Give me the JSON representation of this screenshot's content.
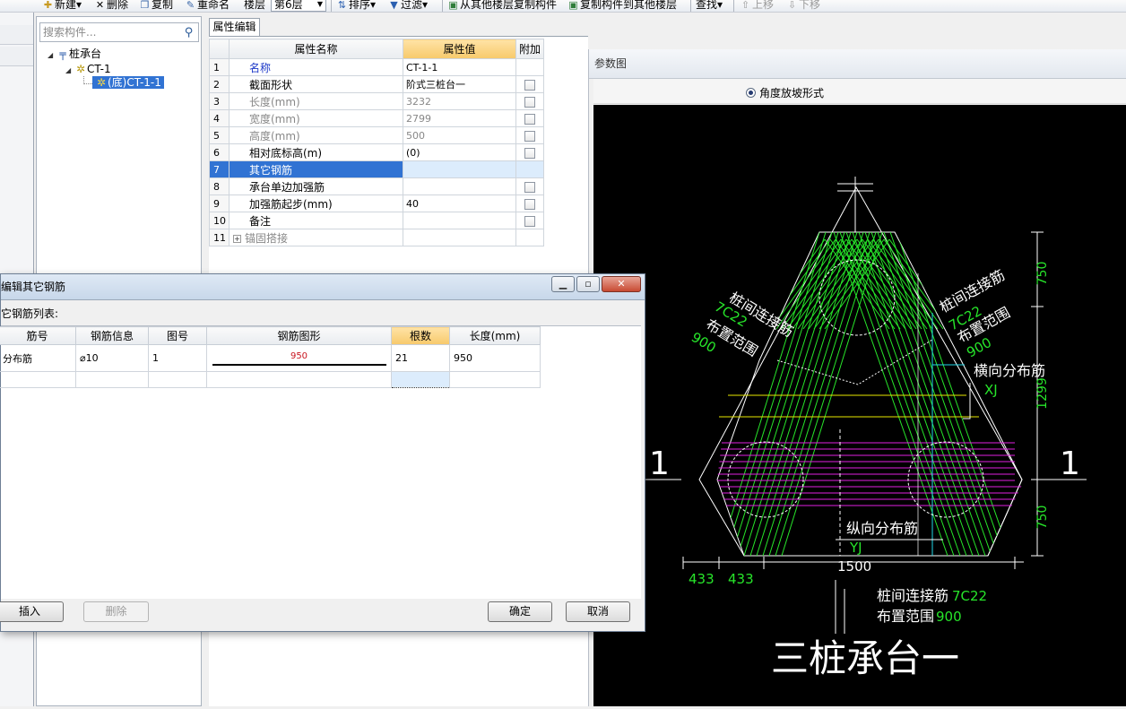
{
  "toolbar": {
    "new_label": "新建",
    "delete_label": "删除",
    "copy_label": "复制",
    "rename_label": "重命名",
    "floor_label": "楼层",
    "floor_value": "第6层",
    "sort_label": "排序",
    "filter_label": "过滤",
    "copy_from_label": "从其他楼层复制构件",
    "copy_to_label": "复制构件到其他楼层",
    "find_label": "查找",
    "up_label": "上移",
    "down_label": "下移"
  },
  "tree": {
    "search_placeholder": "搜索构件...",
    "root_label": "桩承台",
    "child_label": "CT-1",
    "leaf_label": "(底)CT-1-1"
  },
  "properties": {
    "tab_label": "属性编辑",
    "headers": {
      "name": "属性名称",
      "value": "属性值",
      "extra": "附加"
    },
    "rows": [
      {
        "no": "1",
        "name": "名称",
        "value": "CT-1-1"
      },
      {
        "no": "2",
        "name": "截面形状",
        "value": "阶式三桩台一"
      },
      {
        "no": "3",
        "name": "长度(mm)",
        "value": "3232"
      },
      {
        "no": "4",
        "name": "宽度(mm)",
        "value": "2799"
      },
      {
        "no": "5",
        "name": "高度(mm)",
        "value": "500"
      },
      {
        "no": "6",
        "name": "相对底标高(m)",
        "value": "(0)"
      },
      {
        "no": "7",
        "name": "其它钢筋",
        "value": ""
      },
      {
        "no": "8",
        "name": "承台单边加强筋",
        "value": ""
      },
      {
        "no": "9",
        "name": "加强筋起步(mm)",
        "value": "40"
      },
      {
        "no": "10",
        "name": "备注",
        "value": ""
      },
      {
        "no": "11",
        "name": "锚固搭接",
        "value": ""
      }
    ]
  },
  "param": {
    "title": "参数图",
    "radio_label": "角度放坡形式"
  },
  "cad": {
    "left_side": "1",
    "right_side": "1",
    "ul_label1": "桩间连接筋",
    "ul_val1": "7C22",
    "ul_label2": "布置范围",
    "ul_val2": "900",
    "ur_label1": "桩间连接筋",
    "ur_val1": "7C22",
    "ur_label2": "布置范围",
    "ur_val2": "900",
    "horiz_label": "横向分布筋",
    "horiz_code": "XJ",
    "vert_label": "纵向分布筋",
    "vert_code": "YJ",
    "dim_750_top": "750",
    "dim_1299": "1299",
    "dim_750_bot": "750",
    "dim_433_a": "433",
    "dim_433_b": "433",
    "dim_1500": "1500",
    "bot_label1": "桩间连接筋",
    "bot_val1": "7C22",
    "bot_label2": "布置范围",
    "bot_val2": "900",
    "big_title": "三桩承台一"
  },
  "dialog": {
    "title": "编辑其它钢筋",
    "list_label": "它钢筋列表:",
    "headers": [
      "筋号",
      "钢筋信息",
      "图号",
      "钢筋图形",
      "根数",
      "长度(mm)"
    ],
    "row": {
      "name": "分布筋",
      "info": "⌀10",
      "fig": "1",
      "shape_len": "950",
      "count": "21",
      "length": "950"
    },
    "btn_insert": "插入",
    "btn_delete": "删除",
    "btn_ok": "确定",
    "btn_cancel": "取消"
  },
  "colors": {
    "cad_green": "#27e52a",
    "cad_magenta": "#e020e0",
    "cad_yellow": "#e8e800",
    "cad_cyan": "#20d8e8",
    "select_blue": "#3173d3"
  }
}
